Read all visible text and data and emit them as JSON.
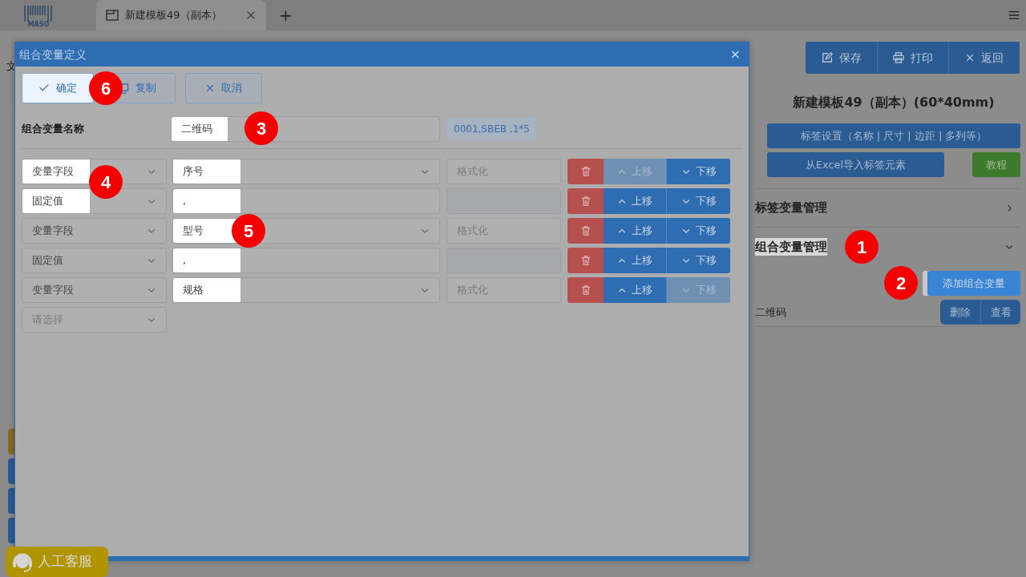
{
  "app": {
    "logo_text": "MASO",
    "tabs": [
      {
        "label": "新建模板49（副本）",
        "selected": true
      }
    ],
    "add_tab": "+"
  },
  "left_stub": {
    "text": "文"
  },
  "side_tabs": [
    {
      "color": "#8a6a22"
    },
    {
      "color": "#2a5b93"
    },
    {
      "color": "#2a5b93"
    },
    {
      "color": "#2a5b93"
    }
  ],
  "dialog": {
    "title": "组合变量定义",
    "close": "×",
    "buttons": [
      {
        "label": "确定",
        "highlighted": true,
        "marker": "6"
      },
      {
        "label": "复制",
        "highlighted": false
      },
      {
        "label": "取消",
        "highlighted": false
      }
    ],
    "name_label": "组合变量名称",
    "name_value": "二维码",
    "name_highlighted": true,
    "name_marker": "3",
    "preview": "0001,SBEB ,1*5",
    "rows": [
      {
        "type": "变量字段",
        "type_highlighted": true,
        "marker": "4",
        "kind": "select",
        "value": "序号",
        "value_highlighted": true,
        "format_disabled": false,
        "format_placeholder": "格式化",
        "up": "上移",
        "up_disabled": true,
        "down": "下移",
        "down_disabled": false
      },
      {
        "type": "固定值",
        "type_highlighted": true,
        "kind": "text",
        "value": ",",
        "value_highlighted": true,
        "format_disabled": true,
        "up": "上移",
        "up_disabled": false,
        "down": "下移",
        "down_disabled": false
      },
      {
        "type": "变量字段",
        "type_highlighted": false,
        "kind": "select",
        "value": "型号",
        "value_highlighted": true,
        "value_marker": "5",
        "format_disabled": false,
        "format_placeholder": "格式化",
        "up": "上移",
        "up_disabled": false,
        "down": "下移",
        "down_disabled": false
      },
      {
        "type": "固定值",
        "type_highlighted": false,
        "kind": "text",
        "value": ",",
        "value_highlighted": true,
        "format_disabled": true,
        "up": "上移",
        "up_disabled": false,
        "down": "下移",
        "down_disabled": false
      },
      {
        "type": "变量字段",
        "type_highlighted": false,
        "kind": "select",
        "value": "规格",
        "value_highlighted": true,
        "format_disabled": false,
        "format_placeholder": "格式化",
        "up": "上移",
        "up_disabled": false,
        "down": "下移",
        "down_disabled": true
      }
    ],
    "new_row_placeholder": "请选择"
  },
  "panel": {
    "toolbar": [
      {
        "label": "保存"
      },
      {
        "label": "打印"
      },
      {
        "label": "返回"
      }
    ],
    "title": "新建模板49（副本）(60*40mm)",
    "settings_button": "标签设置（名称 | 尺寸 | 边距 | 多列等）",
    "import_button": "从Excel导入标签元素",
    "tutorial_button": "教程",
    "sections": [
      {
        "title": "标签变量管理",
        "expanded": false,
        "highlighted": false
      },
      {
        "title": "组合变量管理",
        "expanded": true,
        "highlighted": true,
        "marker": "1"
      }
    ],
    "add_button": {
      "label": "添加组合变量",
      "highlighted": true,
      "marker": "2"
    },
    "variables": [
      {
        "name": "二维码",
        "delete": "删除",
        "view": "查看"
      }
    ]
  },
  "support": {
    "label": "人工客服"
  }
}
